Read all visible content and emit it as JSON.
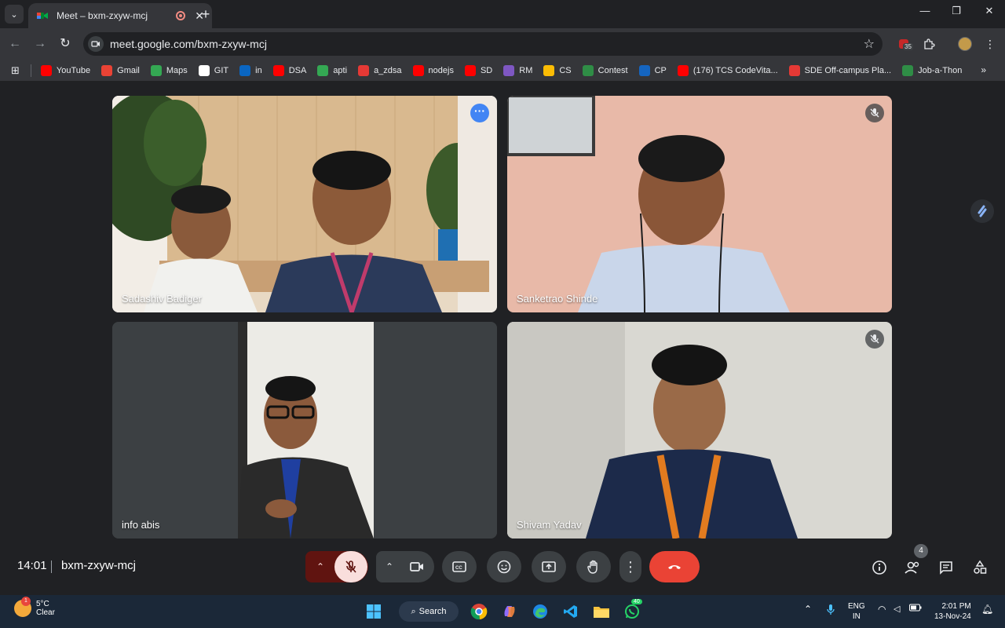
{
  "browser": {
    "tab_title": "Meet – bxm-zxyw-mcj",
    "url": "meet.google.com/bxm-zxyw-mcj",
    "extension_badge": "35",
    "bookmarks": [
      {
        "label": "YouTube",
        "icon": "youtube-icon",
        "color": "#ff0000"
      },
      {
        "label": "Gmail",
        "icon": "gmail-icon",
        "color": "#ea4335"
      },
      {
        "label": "Maps",
        "icon": "maps-icon",
        "color": "#34a853"
      },
      {
        "label": "GIT",
        "icon": "github-icon",
        "color": "#ffffff"
      },
      {
        "label": "in",
        "icon": "linkedin-icon",
        "color": "#0a66c2"
      },
      {
        "label": "DSA",
        "icon": "youtube-icon",
        "color": "#ff0000"
      },
      {
        "label": "apti",
        "icon": "leaf-icon",
        "color": "#34a853"
      },
      {
        "label": "a_zdsa",
        "icon": "tuf-icon",
        "color": "#e53935"
      },
      {
        "label": "nodejs",
        "icon": "youtube-icon",
        "color": "#ff0000"
      },
      {
        "label": "SD",
        "icon": "youtube-icon",
        "color": "#ff0000"
      },
      {
        "label": "RM",
        "icon": "rm-icon",
        "color": "#7e57c2"
      },
      {
        "label": "CS",
        "icon": "drive-icon",
        "color": "#fbbc04"
      },
      {
        "label": "Contest",
        "icon": "gfg-icon",
        "color": "#2f8d46"
      },
      {
        "label": "CP",
        "icon": "codeforces-icon",
        "color": "#1565c0"
      },
      {
        "label": "(176) TCS CodeVita...",
        "icon": "youtube-icon",
        "color": "#ff0000"
      },
      {
        "label": "SDE Off-campus Pla...",
        "icon": "tuf-icon",
        "color": "#e53935"
      },
      {
        "label": "Job-a-Thon",
        "icon": "gfg-icon",
        "color": "#2f8d46"
      }
    ]
  },
  "meet": {
    "time": "14:01",
    "code": "bxm-zxyw-mcj",
    "participant_count": "4",
    "participants": [
      {
        "name": "Sadashiv Badiger",
        "muted": false,
        "active": true
      },
      {
        "name": "Sanketrao Shinde",
        "muted": true,
        "active": false
      },
      {
        "name": "info abis",
        "muted": false,
        "active": false
      },
      {
        "name": "Shivam Yadav",
        "muted": true,
        "active": false
      }
    ],
    "colors": {
      "accent": "#8ab4f8",
      "end_call": "#ea4335",
      "mic_off_bg": "#f9dedc",
      "mic_off_chevron_bg": "#601410"
    }
  },
  "taskbar": {
    "temperature": "5°C",
    "condition": "Clear",
    "weather_badge": "1",
    "search_label": "Search",
    "whatsapp_badge": "40",
    "lang_line1": "ENG",
    "lang_line2": "IN",
    "time": "2:01 PM",
    "date": "13-Nov-24"
  }
}
